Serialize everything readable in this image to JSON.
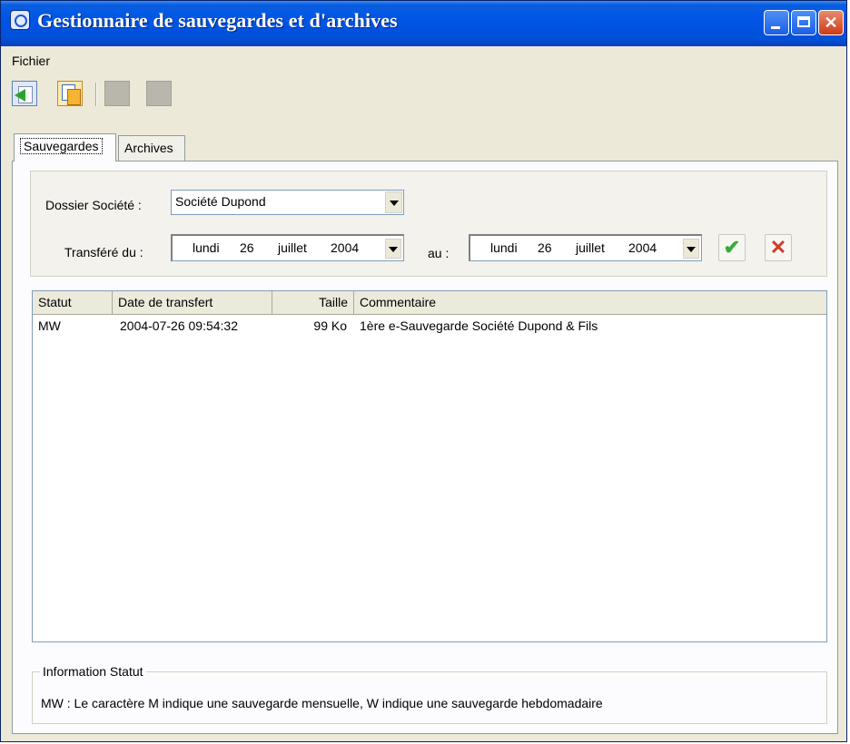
{
  "window": {
    "title": "Gestionnaire de sauvegardes et d'archives"
  },
  "menu": {
    "items": [
      "Fichier"
    ]
  },
  "tabs": [
    {
      "label": "Sauvegardes",
      "active": true
    },
    {
      "label": "Archives",
      "active": false
    }
  ],
  "filters": {
    "company_label": "Dossier Société :",
    "company_value": "Société Dupond",
    "transfer_label": "Transféré du :",
    "to_label": "au :",
    "date_from": {
      "day_name": "lundi",
      "day": "26",
      "month": "juillet",
      "year": "2004"
    },
    "date_to": {
      "day_name": "lundi",
      "day": "26",
      "month": "juillet",
      "year": "2004"
    }
  },
  "table": {
    "columns": [
      "Statut",
      "Date de transfert",
      "Taille",
      "Commentaire"
    ],
    "rows": [
      {
        "statut": "MW",
        "date": "2004-07-26 09:54:32",
        "taille": "99 Ko",
        "commentaire": "1ère e-Sauvegarde Société Dupond & Fils"
      }
    ]
  },
  "info": {
    "legend": "Information Statut",
    "text": "MW : Le caractère M indique une sauvegarde mensuelle, W indique une sauvegarde hebdomadaire"
  },
  "icons": [
    "app-icon",
    "minimize-icon",
    "maximize-icon",
    "close-icon",
    "import-icon",
    "copy-icon",
    "disabled-tool-icon",
    "apply-check-icon",
    "cancel-x-icon"
  ],
  "colors": {
    "titlebar": "#0055e5",
    "window_bg": "#ece9d8",
    "check": "#3aaa3a",
    "cancel": "#d23a2a"
  }
}
